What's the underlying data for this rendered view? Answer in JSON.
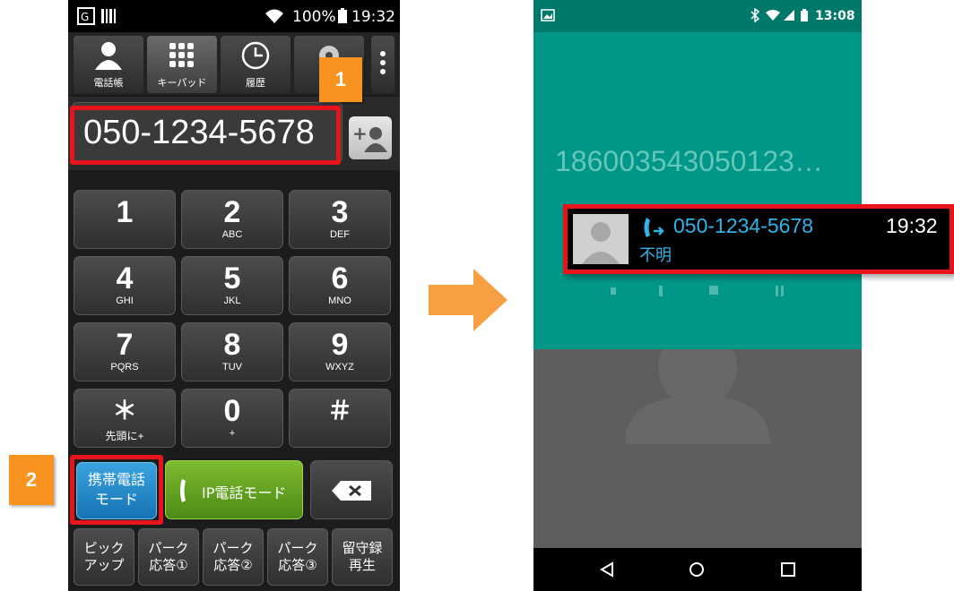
{
  "left_phone": {
    "status_bar": {
      "battery": "100%",
      "time": "19:32"
    },
    "tabs": [
      {
        "label": "電話帳",
        "icon": "person-icon"
      },
      {
        "label": "キーパッド",
        "icon": "keypad-icon"
      },
      {
        "label": "履歴",
        "icon": "clock-icon"
      }
    ],
    "dialed_number": "050-1234-5678",
    "keys": [
      {
        "main": "1",
        "sub": ""
      },
      {
        "main": "2",
        "sub": "ABC"
      },
      {
        "main": "3",
        "sub": "DEF"
      },
      {
        "main": "4",
        "sub": "GHI"
      },
      {
        "main": "5",
        "sub": "JKL"
      },
      {
        "main": "6",
        "sub": "MNO"
      },
      {
        "main": "7",
        "sub": "PQRS"
      },
      {
        "main": "8",
        "sub": "TUV"
      },
      {
        "main": "9",
        "sub": "WXYZ"
      },
      {
        "main": "＊",
        "sub": "先頭に+"
      },
      {
        "main": "0",
        "sub": "+"
      },
      {
        "main": "＃",
        "sub": ""
      }
    ],
    "mode_buttons": {
      "mobile_line1": "携帯電話",
      "mobile_line2": "モード",
      "ip_mode": "IP電話モード"
    },
    "bottom_keys": [
      {
        "line1": "ピック",
        "line2": "アップ"
      },
      {
        "line1": "パーク",
        "line2": "応答①"
      },
      {
        "line1": "パーク",
        "line2": "応答②"
      },
      {
        "line1": "パーク",
        "line2": "応答③"
      },
      {
        "line1": "留守録",
        "line2": "再生"
      }
    ],
    "callouts": {
      "step1": "1",
      "step2": "2"
    }
  },
  "right_phone": {
    "status_bar": {
      "time": "13:08"
    },
    "dialing_number": "186003543050123…",
    "notification": {
      "number": "050-1234-5678",
      "time": "19:32",
      "status": "不明"
    }
  },
  "colors": {
    "highlight_red": "#e8141c",
    "callout_orange": "#f7931e",
    "mobile_mode_blue": "#1e88c8",
    "ip_mode_green": "#5e9a1e",
    "dialer_teal": "#009688",
    "notification_blue": "#2fb3e8"
  }
}
